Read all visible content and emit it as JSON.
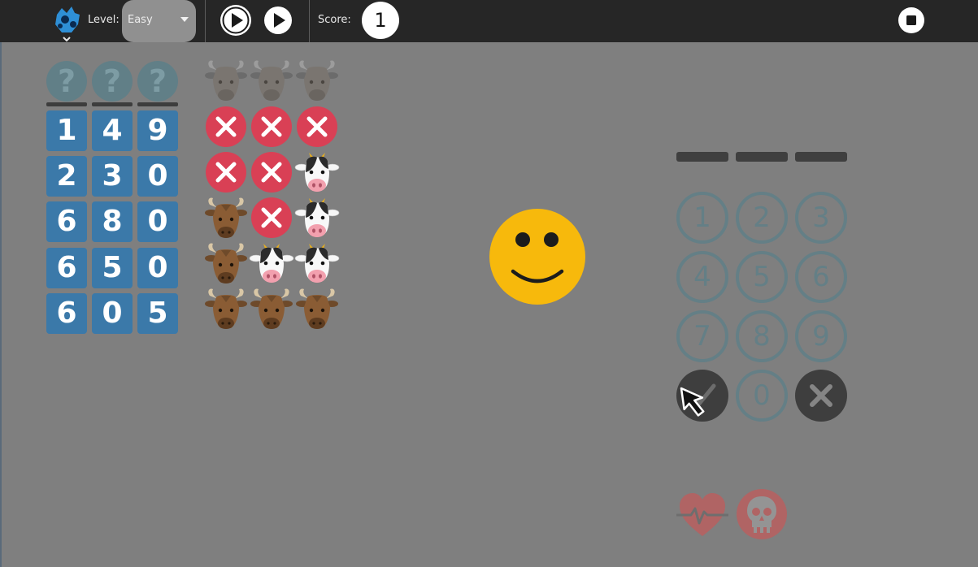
{
  "toolbar": {
    "level_label": "Level:",
    "level_value": "Easy",
    "score_label": "Score:",
    "score_value": "1",
    "icons": [
      "activity-icon",
      "chevron-down-icon",
      "play-circle-icon",
      "play-icon",
      "stop-icon"
    ]
  },
  "guess": {
    "hidden_slots": [
      "?",
      "?",
      "?"
    ],
    "rows": [
      {
        "digits": [
          "1",
          "4",
          "9"
        ],
        "results": [
          "miss",
          "miss",
          "miss"
        ]
      },
      {
        "digits": [
          "2",
          "3",
          "0"
        ],
        "results": [
          "miss",
          "miss",
          "cow"
        ]
      },
      {
        "digits": [
          "6",
          "8",
          "0"
        ],
        "results": [
          "bull",
          "miss",
          "cow"
        ]
      },
      {
        "digits": [
          "6",
          "5",
          "0"
        ],
        "results": [
          "bull",
          "cow",
          "cow"
        ]
      },
      {
        "digits": [
          "6",
          "0",
          "5"
        ],
        "results": [
          "bull",
          "bull",
          "bull"
        ]
      }
    ],
    "header_icons": [
      "bull-icon",
      "bull-icon",
      "bull-icon"
    ]
  },
  "status": {
    "face": "smiley-icon"
  },
  "keypad": {
    "keys": [
      "1",
      "2",
      "3",
      "4",
      "5",
      "6",
      "7",
      "8",
      "9",
      "0"
    ],
    "ok_icon": "checkmark-icon",
    "cancel_icon": "cancel-icon"
  },
  "bottom_icons": [
    "heart-icon",
    "skull-icon"
  ],
  "colors": {
    "toolbar_bg": "#262626",
    "game_bg": "#7f7f7f",
    "digit_tile": "#3b79a9",
    "miss_red": "#d94055",
    "smiley_yellow": "#f7b90c",
    "keypad_ring": "#647f86"
  }
}
